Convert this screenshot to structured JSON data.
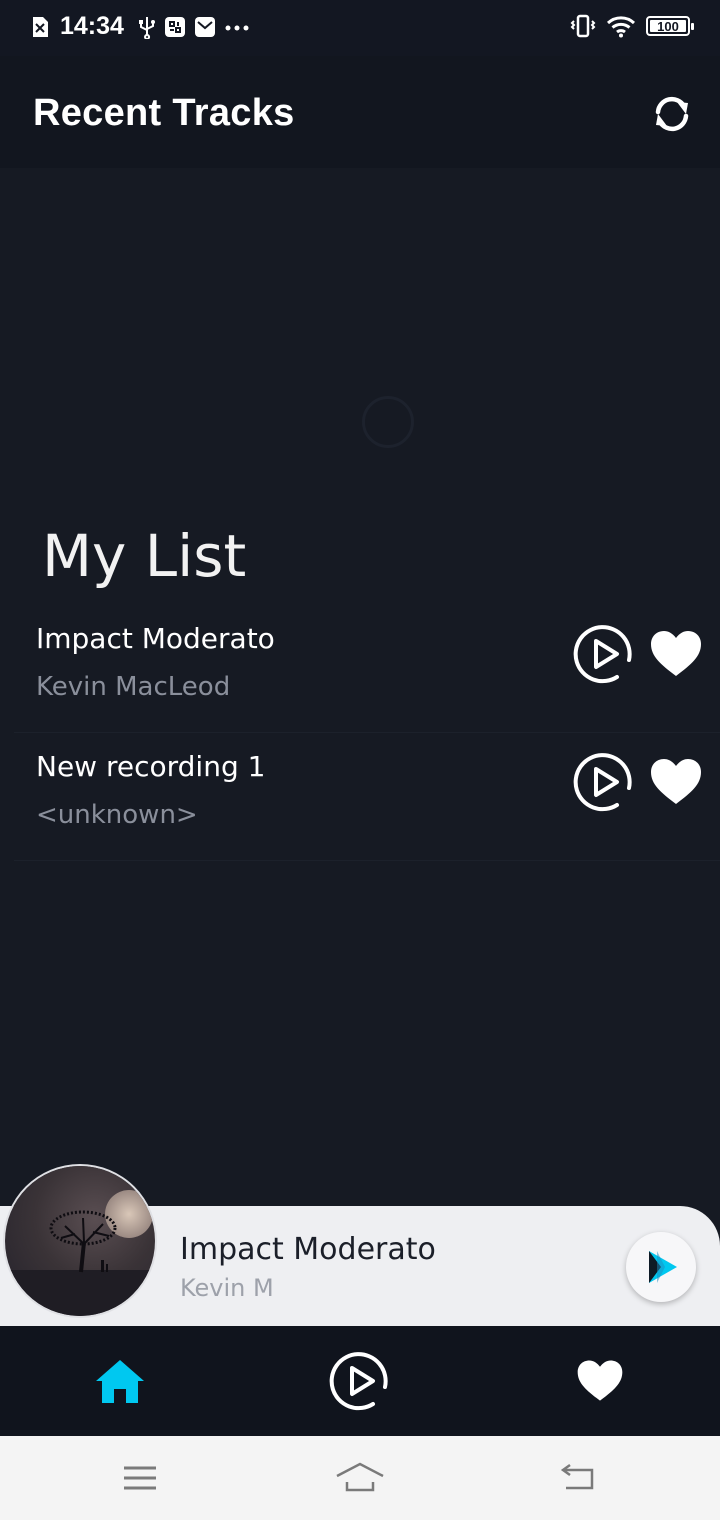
{
  "status_bar": {
    "time": "14:34",
    "battery": "100",
    "icons": [
      "sim-off-icon",
      "usb-icon",
      "settings-app-icon",
      "mail-icon",
      "more-dots-icon",
      "vibrate-icon",
      "wifi-icon",
      "battery-icon"
    ]
  },
  "header": {
    "title": "Recent Tracks",
    "refresh_icon": "refresh-icon"
  },
  "my_list": {
    "title": "My List",
    "tracks": [
      {
        "title": "Impact Moderato",
        "artist": "Kevin MacLeod",
        "favorite": true
      },
      {
        "title": "New recording 1",
        "artist": "<unknown>",
        "favorite": true
      }
    ]
  },
  "mini_player": {
    "title": "Impact Moderato",
    "artist": "Kevin M",
    "play_icon": "play-icon"
  },
  "bottom_nav": {
    "items": [
      {
        "name": "home",
        "icon": "home-icon",
        "active": true
      },
      {
        "name": "player",
        "icon": "play-circle-icon",
        "active": false
      },
      {
        "name": "favorites",
        "icon": "heart-icon",
        "active": false
      }
    ]
  },
  "system_nav": [
    "menu-icon",
    "home-icon",
    "back-icon"
  ],
  "colors": {
    "background": "#161a23",
    "header": "#12161f",
    "accent": "#00c8f0",
    "text_secondary": "#8a8f9b",
    "mini_player_bg": "#eeeff2"
  }
}
